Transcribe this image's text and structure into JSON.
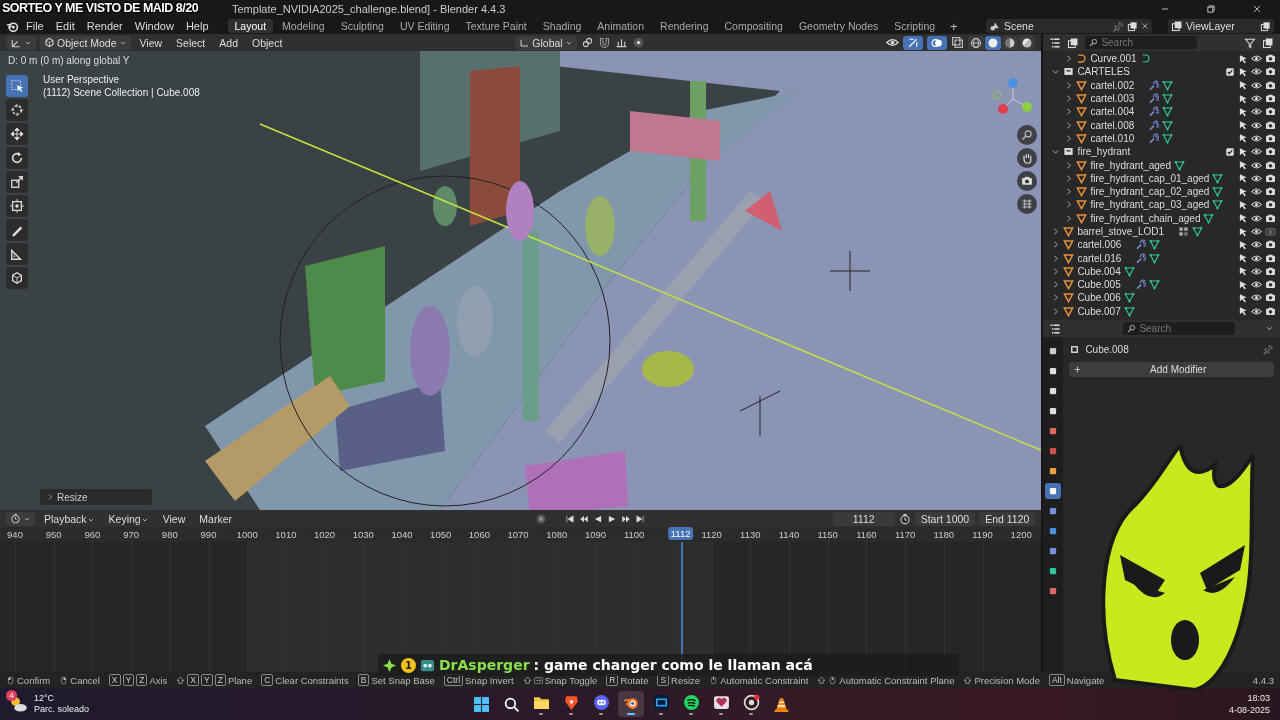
{
  "overlay_banner": "SORTEO Y ME VISTO DE MAID 8/20",
  "window": {
    "title": "Template_NVIDIA2025_challenge.blend] - Blender 4.4.3"
  },
  "menu": [
    "File",
    "Edit",
    "Render",
    "Window",
    "Help"
  ],
  "workspaces": [
    {
      "label": "Layout",
      "selected": true
    },
    {
      "label": "Modeling",
      "selected": false
    },
    {
      "label": "Sculpting",
      "selected": false
    },
    {
      "label": "UV Editing",
      "selected": false
    },
    {
      "label": "Texture Paint",
      "selected": false
    },
    {
      "label": "Shading",
      "selected": false
    },
    {
      "label": "Animation",
      "selected": false
    },
    {
      "label": "Rendering",
      "selected": false
    },
    {
      "label": "Compositing",
      "selected": false
    },
    {
      "label": "Geometry Nodes",
      "selected": false
    },
    {
      "label": "Scripting",
      "selected": false
    }
  ],
  "add_workspace": "+",
  "scene": "Scene",
  "view_layer": "ViewLayer",
  "viewport": {
    "mode": "Object Mode",
    "menus": [
      "View",
      "Select",
      "Add",
      "Object"
    ],
    "orientation": "Global",
    "status": "D: 0 m (0 m) along global Y",
    "info": [
      "User Perspective",
      "(1112) Scene Collection | Cube.008"
    ],
    "operator_panel": "Resize",
    "tools": [
      {
        "kind": "select",
        "selected": true
      },
      {
        "kind": "cursor",
        "selected": false
      },
      {
        "kind": "move",
        "selected": false
      },
      {
        "kind": "rotate",
        "selected": false
      },
      {
        "kind": "scale",
        "selected": false
      },
      {
        "kind": "transform",
        "selected": false
      },
      {
        "kind": "annotate",
        "selected": false
      },
      {
        "kind": "measure",
        "selected": false
      },
      {
        "kind": "add_cube",
        "selected": false
      }
    ],
    "shading": [
      {
        "kind": "wireframe",
        "selected": false
      },
      {
        "kind": "solid",
        "selected": true
      },
      {
        "kind": "material",
        "selected": false
      },
      {
        "kind": "rendered",
        "selected": false
      }
    ]
  },
  "outliner": {
    "search_placeholder": "Search",
    "items": [
      {
        "children": [
          {
            "name": "Curve.001",
            "kind": "curve",
            "expanded": false,
            "render_enabled": true
          }
        ]
      },
      {
        "name": "CARTELES",
        "kind": "collection",
        "expanded": true,
        "checked": true,
        "render_enabled": true,
        "children": [
          {
            "name": "cartel.002",
            "kind": "mesh",
            "expanded": false,
            "modifiers": true,
            "render_enabled": true
          },
          {
            "name": "cartel.003",
            "kind": "mesh",
            "expanded": false,
            "modifiers": true,
            "render_enabled": true
          },
          {
            "name": "cartel.004",
            "kind": "mesh",
            "expanded": false,
            "modifiers": true,
            "render_enabled": true
          },
          {
            "name": "cartel.008",
            "kind": "mesh",
            "expanded": false,
            "modifiers": true,
            "render_enabled": true
          },
          {
            "name": "cartel.010",
            "kind": "mesh",
            "expanded": false,
            "modifiers": true,
            "render_enabled": true
          }
        ]
      },
      {
        "name": "fire_hydrant",
        "kind": "collection",
        "expanded": true,
        "checked": true,
        "render_enabled": true,
        "children": [
          {
            "name": "fire_hydrant_aged",
            "kind": "mesh",
            "expanded": false,
            "render_enabled": true
          },
          {
            "name": "fire_hydrant_cap_01_aged",
            "kind": "mesh",
            "expanded": false,
            "render_enabled": true
          },
          {
            "name": "fire_hydrant_cap_02_aged",
            "kind": "mesh",
            "expanded": false,
            "render_enabled": true
          },
          {
            "name": "fire_hydrant_cap_03_aged",
            "kind": "mesh",
            "expanded": false,
            "render_enabled": true
          },
          {
            "name": "fire_hydrant_chain_aged",
            "kind": "mesh",
            "expanded": false,
            "render_enabled": true
          }
        ]
      },
      {
        "name": "barrel_stove_LOD1",
        "kind": "mesh",
        "expanded": false,
        "instancing": true,
        "render_enabled": false
      },
      {
        "name": "cartel.006",
        "kind": "mesh",
        "expanded": false,
        "modifiers": true,
        "render_enabled": true
      },
      {
        "name": "cartel.016",
        "kind": "mesh",
        "expanded": false,
        "modifiers": true,
        "render_enabled": true
      },
      {
        "name": "Cube.004",
        "kind": "mesh",
        "expanded": false,
        "render_enabled": true
      },
      {
        "name": "Cube.005",
        "kind": "mesh",
        "expanded": false,
        "modifiers": true,
        "render_enabled": true
      },
      {
        "name": "Cube.006",
        "kind": "mesh",
        "expanded": false,
        "render_enabled": true
      },
      {
        "name": "Cube.007",
        "kind": "mesh",
        "expanded": false,
        "render_enabled": true
      }
    ]
  },
  "properties": {
    "search_placeholder": "Search",
    "object": "Cube.008",
    "add_button": "Add Modifier",
    "tabs": [
      {
        "kind": "tool",
        "selected": false
      },
      {
        "kind": "render",
        "selected": false
      },
      {
        "kind": "output",
        "selected": false
      },
      {
        "kind": "view_layer",
        "selected": false
      },
      {
        "kind": "scene",
        "selected": false
      },
      {
        "kind": "world",
        "selected": false
      },
      {
        "kind": "object",
        "selected": false
      },
      {
        "kind": "modifiers",
        "selected": true
      },
      {
        "kind": "particles",
        "selected": false
      },
      {
        "kind": "physics",
        "selected": false
      },
      {
        "kind": "constraints",
        "selected": false
      },
      {
        "kind": "data",
        "selected": false
      },
      {
        "kind": "material",
        "selected": false
      }
    ]
  },
  "timeline": {
    "menus": [
      "Playback",
      "Keying",
      "View",
      "Marker"
    ],
    "current_frame": "1112",
    "start": {
      "label": "Start",
      "value": "1000"
    },
    "end": {
      "label": "End",
      "value": "1120"
    },
    "ruler": [
      "940",
      "950",
      "960",
      "970",
      "980",
      "990",
      "1000",
      "1010",
      "1020",
      "1030",
      "1040",
      "1050",
      "1060",
      "1070",
      "1080",
      "1090",
      "1100",
      "1120",
      "1130",
      "1140",
      "1150",
      "1160",
      "1170",
      "1180",
      "1190",
      "1200"
    ],
    "playhead": "1112"
  },
  "chat": {
    "badge": "1",
    "user": "DrAsperger",
    "message": ": game changer como le llaman acá"
  },
  "status_bar": {
    "hints": [
      {
        "kind": "left_click",
        "label": "Confirm"
      },
      {
        "kind": "right_click",
        "label": "Cancel"
      },
      {
        "kind": "keys",
        "keys": [
          "X",
          "Y",
          "Z"
        ],
        "label": "Axis"
      },
      {
        "kind": "keys",
        "shift": true,
        "keys": [
          "X",
          "Y",
          "Z"
        ],
        "label": "Plane"
      },
      {
        "kind": "keys",
        "keys": [
          "C"
        ],
        "label": "Clear Constraints"
      },
      {
        "kind": "keys",
        "keys": [
          "B"
        ],
        "label": "Set Snap Base"
      },
      {
        "kind": "keys",
        "keys": [
          "Ctrl"
        ],
        "label": "Snap Invert"
      },
      {
        "kind": "tab",
        "shift": true,
        "label": "Snap Toggle"
      },
      {
        "kind": "keys",
        "keys": [
          "R"
        ],
        "label": "Rotate"
      },
      {
        "kind": "keys",
        "keys": [
          "S"
        ],
        "label": "Resize"
      },
      {
        "kind": "middle_click",
        "label": "Automatic Constraint"
      },
      {
        "kind": "middle_click",
        "shift": true,
        "label": "Automatic Constraint Plane"
      },
      {
        "kind": "keys",
        "shift": true,
        "label": "Precision Mode"
      },
      {
        "kind": "keys",
        "keys": [
          "Alt"
        ],
        "label": "Navigate"
      }
    ],
    "version": "4.4.3"
  },
  "taskbar": {
    "weather": {
      "badge": "4",
      "temperature": "12°C",
      "condition": "Parc. soleado"
    },
    "apps": [
      {
        "kind": "start",
        "active": false,
        "running": false
      },
      {
        "kind": "search",
        "active": false,
        "running": false
      },
      {
        "kind": "files",
        "active": false,
        "running": true
      },
      {
        "kind": "browser",
        "active": false,
        "running": true
      },
      {
        "kind": "discord",
        "active": false,
        "running": true
      },
      {
        "kind": "blender",
        "active": true,
        "running": true
      },
      {
        "kind": "photoshop",
        "active": false,
        "running": true
      },
      {
        "kind": "music",
        "active": false,
        "running": true
      },
      {
        "kind": "stream",
        "active": false,
        "running": true
      },
      {
        "kind": "recorder",
        "active": false,
        "running": true
      },
      {
        "kind": "media",
        "active": false,
        "running": false
      }
    ],
    "time": "18:03",
    "date": "4-08-2025"
  }
}
